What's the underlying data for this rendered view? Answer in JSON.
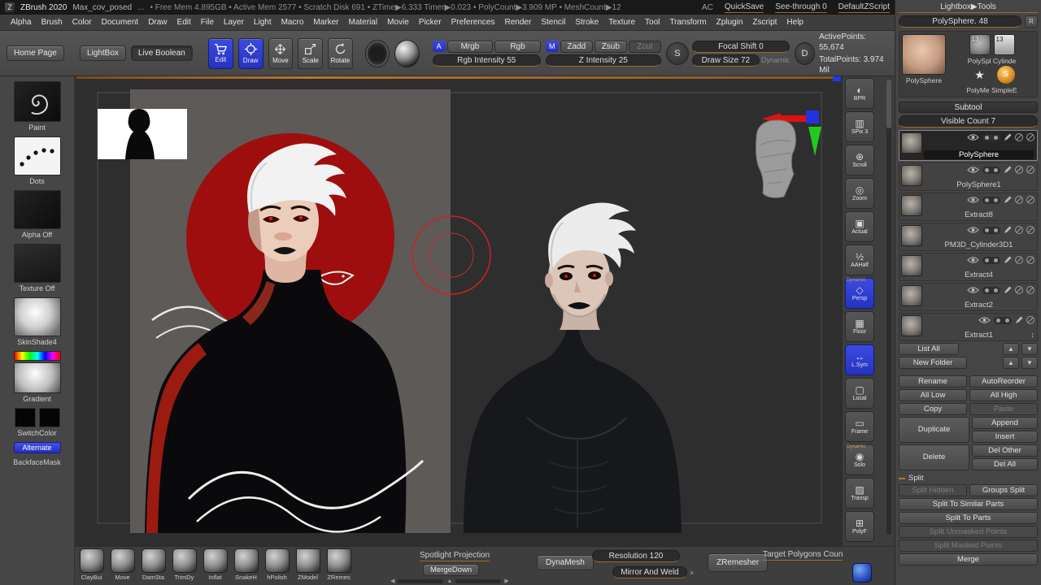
{
  "colors": {
    "accent_blue": "#2e3ed2",
    "accent_orange": "#b5762f",
    "canvas_red": "#a60f0f"
  },
  "titlebar": {
    "app_title": "ZBrush 2020",
    "doc_name": "Max_cov_posed",
    "ellipsis": "...",
    "stats": "• Free Mem 4.895GB • Active Mem 2577 • Scratch Disk 691 • ZTime▶6.333 Timer▶0.023 • PolyCount▶3.909 MP • MeshCount▶12",
    "ac": "AC",
    "quicksave": "QuickSave",
    "see_through": "See-through 0",
    "default_zscript": "DefaultZScript"
  },
  "menubar": {
    "items": [
      "Alpha",
      "Brush",
      "Color",
      "Document",
      "Draw",
      "Edit",
      "File",
      "Layer",
      "Light",
      "Macro",
      "Marker",
      "Material",
      "Movie",
      "Picker",
      "Preferences",
      "Render",
      "Stencil",
      "Stroke",
      "Texture",
      "Tool",
      "Transform",
      "Zplugin",
      "Zscript",
      "Help"
    ]
  },
  "shelf": {
    "home_page": "Home Page",
    "lightbox": "LightBox",
    "live_boolean": "Live Boolean",
    "edit": "Edit",
    "draw": "Draw",
    "move": "Move",
    "scale": "Scale",
    "rotate": "Rotate",
    "a_badge": "A",
    "mrgb": "Mrgb",
    "rgb": "Rgb",
    "rgb_intensity": "Rgb Intensity 55",
    "m_badge": "M",
    "zadd": "Zadd",
    "zsub": "Zsub",
    "zcut": "Zcut",
    "z_intensity": "Z Intensity 25",
    "s_badge": "S",
    "focal_shift": "Focal Shift 0",
    "draw_size": "Draw Size 72",
    "dynamic": "Dynamic",
    "d_badge": "D",
    "active_points": "ActivePoints: 55,674",
    "total_points": "TotalPoints: 3.974 Mil"
  },
  "palette": {
    "paint": "Paint",
    "dots": "Dots",
    "alpha_off": "Alpha Off",
    "texture_off": "Texture Off",
    "material": "SkinShade4",
    "gradient": "Gradient",
    "switch_color": "SwitchColor",
    "alternate": "Alternate",
    "backface_mask": "BackfaceMask"
  },
  "strip": {
    "items": [
      {
        "label": "BPR",
        "glyph": "◐"
      },
      {
        "label": "SPix 3",
        "glyph": "▥"
      },
      {
        "label": "Scroll",
        "glyph": "⊕"
      },
      {
        "label": "Zoom",
        "glyph": "◎"
      },
      {
        "label": "Actual",
        "glyph": "▣"
      },
      {
        "label": "AAHalf",
        "glyph": "½"
      },
      {
        "label": "Persp",
        "glyph": "◇",
        "tag": "Dynamic"
      },
      {
        "label": "Floor",
        "glyph": "▦"
      },
      {
        "label": "L.Sym",
        "glyph": "↔"
      },
      {
        "label": "Local",
        "glyph": "▢"
      },
      {
        "label": "Frame",
        "glyph": "▭"
      },
      {
        "label": "Solo",
        "glyph": "◉",
        "tag": "Dynamic"
      },
      {
        "label": "Transp",
        "glyph": "▨"
      },
      {
        "label": "PolyF",
        "glyph": "⊞"
      }
    ]
  },
  "panel": {
    "lightbox_tools": "Lightbox▶Tools",
    "tool_name": "PolySphere. 48",
    "r_button": "R",
    "badge_a": "13",
    "badge_b": "13",
    "star": "★",
    "s_ball": "S",
    "caption_current": "PolySphere",
    "caption_small": "PolySpl Cylinde",
    "caption_simple": "PolyMe SimpleE",
    "subtool_title": "Subtool",
    "visible_count": "Visible Count 7",
    "subtools": [
      {
        "name": "PolySphere"
      },
      {
        "name": "PolySphere1"
      },
      {
        "name": "Extract8"
      },
      {
        "name": "PM3D_Cylinder3D1"
      },
      {
        "name": "Extract4"
      },
      {
        "name": "Extract2"
      },
      {
        "name": "Extract1"
      }
    ],
    "list_all": "List All",
    "new_folder": "New Folder",
    "rename": "Rename",
    "auto_reorder": "AutoReorder",
    "all_low": "All Low",
    "all_high": "All High",
    "copy": "Copy",
    "paste": "Paste",
    "duplicate": "Duplicate",
    "append": "Append",
    "insert": "Insert",
    "delete": "Delete",
    "del_other": "Del Other",
    "del_all": "Del All",
    "split_header": "Split",
    "split_hidden": "Split Hidden",
    "groups_split": "Groups Split",
    "split_similar": "Split To Similar Parts",
    "split_parts": "Split To Parts",
    "split_unmasked": "Split Unmasked Points",
    "split_masked": "Split Masked Points",
    "merge": "Merge"
  },
  "icons": {
    "up": "▲",
    "down": "▼",
    "left": "◀",
    "right": "▶",
    "updown": "↕",
    "close": "×"
  },
  "bottombar": {
    "brushes": [
      "ClayBui",
      "Move",
      "DamSta",
      "TrimDy",
      "Inflat",
      "SnakeH",
      "hPolish",
      "ZModel",
      "ZRemes"
    ],
    "spotlight_projection": "Spotlight Projection",
    "merge_down": "MergeDown",
    "dynamesh": "DynaMesh",
    "resolution": "Resolution 120",
    "mirror_and_weld": "Mirror And Weld",
    "zremesher": "ZRemesher",
    "target_polygons": "Target Polygons Coun"
  }
}
